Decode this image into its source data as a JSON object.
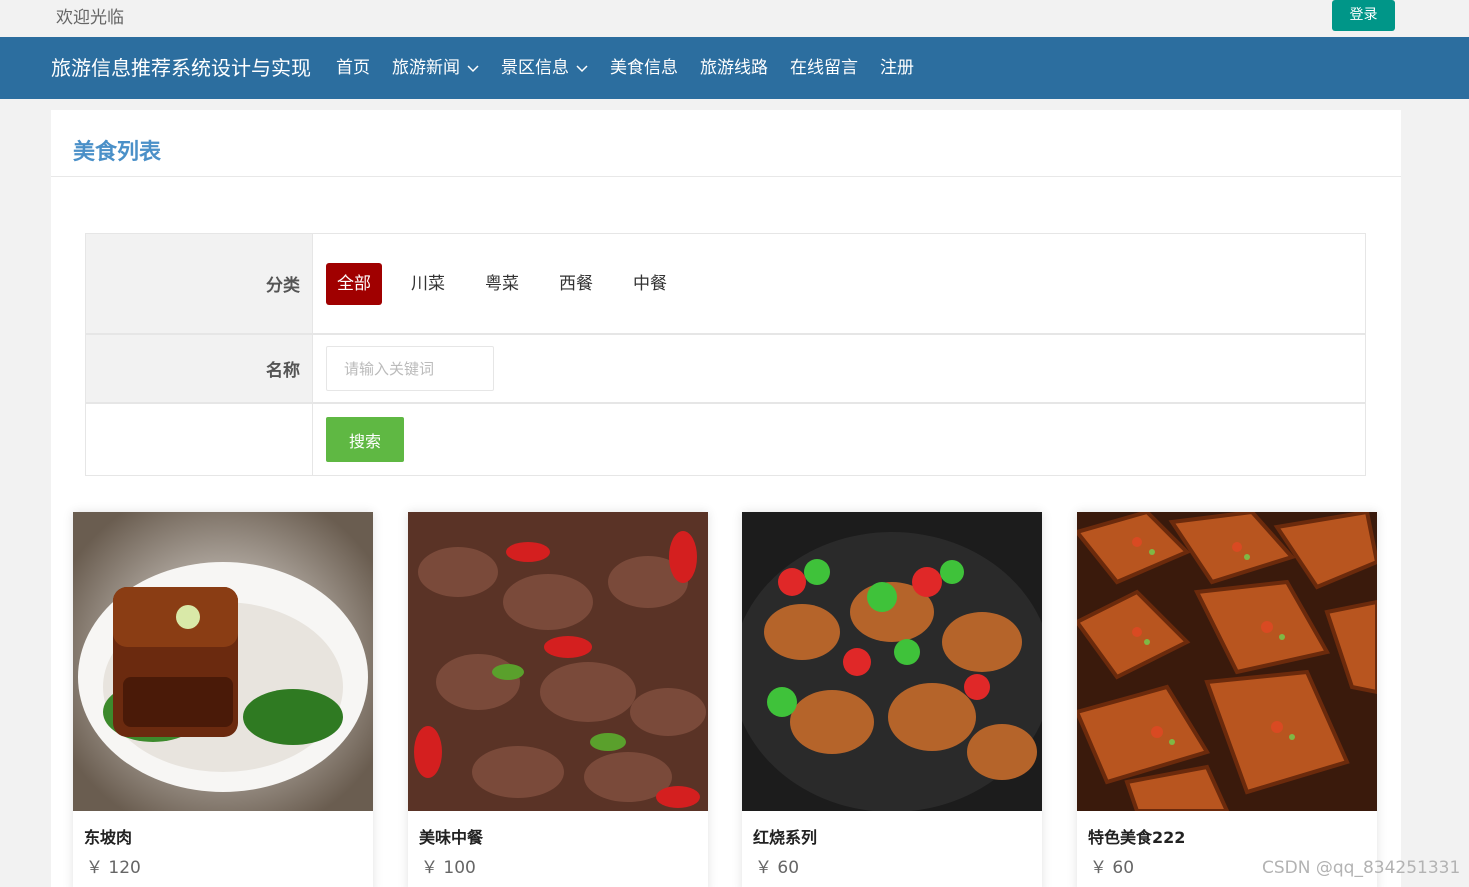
{
  "topbar": {
    "welcome": "欢迎光临",
    "login_label": "登录"
  },
  "navbar": {
    "brand": "旅游信息推荐系统设计与实现",
    "items": [
      {
        "label": "首页",
        "dropdown": false
      },
      {
        "label": "旅游新闻",
        "dropdown": true
      },
      {
        "label": "景区信息",
        "dropdown": true
      },
      {
        "label": "美食信息",
        "dropdown": false
      },
      {
        "label": "旅游线路",
        "dropdown": false
      },
      {
        "label": "在线留言",
        "dropdown": false
      },
      {
        "label": "注册",
        "dropdown": false
      }
    ]
  },
  "panel": {
    "title": "美食列表"
  },
  "filter": {
    "category_label": "分类",
    "categories": [
      "全部",
      "川菜",
      "粤菜",
      "西餐",
      "中餐"
    ],
    "active_category": "全部",
    "name_label": "名称",
    "name_placeholder": "请输入关键词",
    "name_value": "",
    "search_label": "搜索"
  },
  "foods": [
    {
      "name": "东坡肉",
      "price": "￥ 120",
      "image": "braised-pork-photo"
    },
    {
      "name": "美味中餐",
      "price": "￥ 100",
      "image": "stir-fried-liver-photo"
    },
    {
      "name": "红烧系列",
      "price": "￥ 60",
      "image": "braised-intestine-photo"
    },
    {
      "name": "特色美食222",
      "price": "￥ 60",
      "image": "grilled-tofu-photo"
    }
  ],
  "watermark": "CSDN @qq_834251331",
  "colors": {
    "nav": "#2c6e9f",
    "login": "#009688",
    "active_category": "#a00000",
    "search": "#5fb843",
    "title": "#4a90c8"
  }
}
